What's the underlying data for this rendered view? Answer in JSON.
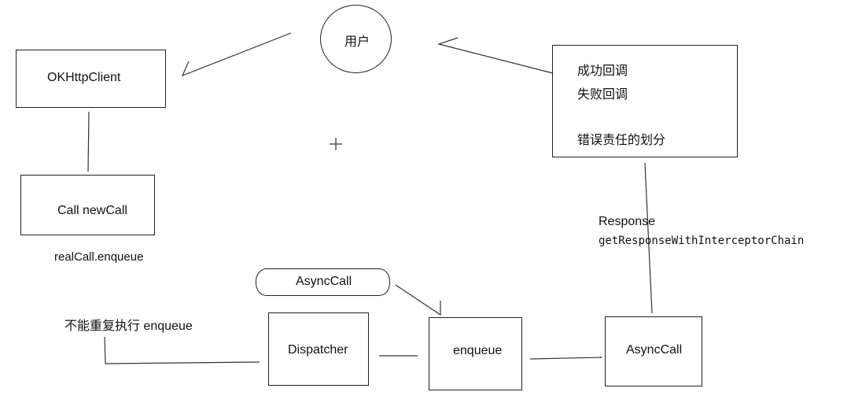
{
  "nodes": {
    "user": "用户",
    "okhttp_client": "OKHttpClient",
    "call_new_call": "Call newCall",
    "dispatcher": "Dispatcher",
    "enqueue": "enqueue",
    "async_call_box": "AsyncCall",
    "async_call_pill": "AsyncCall",
    "result_box": {
      "line1": "成功回调",
      "line2": "失败回调",
      "line3": "错误责任的划分"
    }
  },
  "labels": {
    "real_call_enqueue": "realCall.enqueue",
    "no_repeat_enqueue": "不能重复执行 enqueue",
    "response": "Response",
    "get_response_chain": "getResponseWithInterceptorChain"
  },
  "colors": {
    "stroke": "#222222",
    "background": "#ffffff"
  }
}
